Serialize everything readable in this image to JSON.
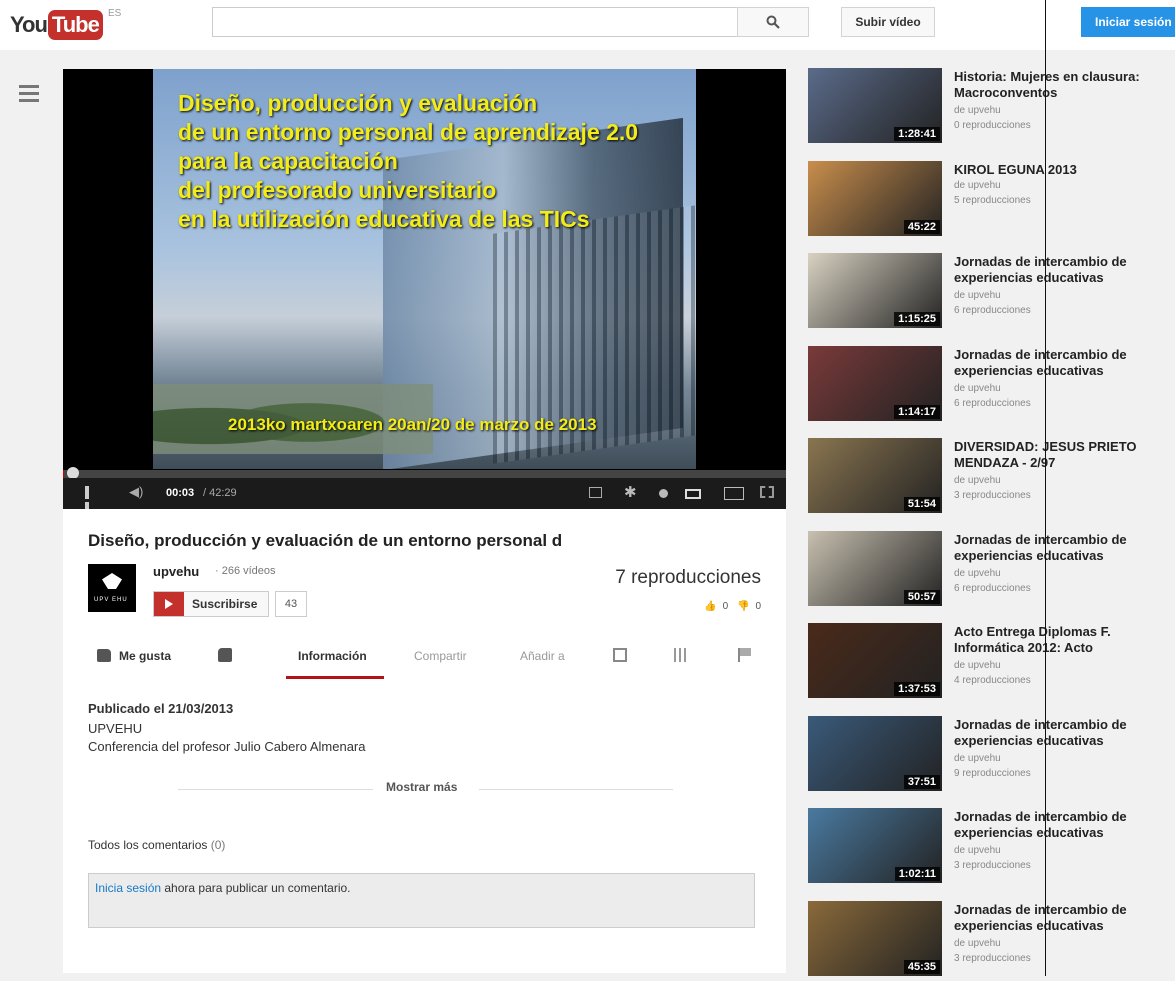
{
  "header": {
    "logo_you": "You",
    "logo_tube": "Tube",
    "locale": "ES",
    "search_placeholder": "",
    "upload_label": "Subir vídeo",
    "signin_label": "Iniciar sesión"
  },
  "player": {
    "slide_title_lines": [
      "Diseño, producción y evaluación",
      "de un entorno personal de aprendizaje 2.0",
      "para la capacitación",
      "del profesorado universitario",
      "en la utilización educativa de las TICs"
    ],
    "slide_date": "2013ko martxoaren 20an/20 de marzo de 2013",
    "time_current": "00:03",
    "time_total": "/ 42:29",
    "progress": 0.001
  },
  "video": {
    "title": "Diseño, producción y evaluación de un entorno personal d",
    "channel": "upvehu",
    "video_count": "· 266 vídeos",
    "subscribe_label": "Suscribirse",
    "subscriber_count": "43",
    "views": "7 reproducciones",
    "likes": "0",
    "dislikes": "0",
    "avatar_text": "UPV   EHU"
  },
  "tabs": {
    "like": "Me gusta",
    "info": "Información",
    "share": "Compartir",
    "add_to": "Añadir a"
  },
  "description": {
    "published": "Publicado el 21/03/2013",
    "line1": "UPVEHU",
    "line2": "Conferencia del profesor Julio Cabero Almenara",
    "show_more": "Mostrar más"
  },
  "comments": {
    "heading": "Todos los comentarios",
    "count": "(0)",
    "signin_link": "Inicia sesión",
    "signin_rest": " ahora para publicar un comentario."
  },
  "related": [
    {
      "title": "Historia: Mujeres en clausura: Macroconventos",
      "by": "de upvehu",
      "views": "0 reproducciones",
      "duration": "1:28:41",
      "color": "#5a6b8a"
    },
    {
      "title": "KIROL EGUNA 2013",
      "by": "de upvehu",
      "views": "5 reproducciones",
      "duration": "45:22",
      "color": "#c98e4c"
    },
    {
      "title": "Jornadas de intercambio de experiencias educativas",
      "by": "de upvehu",
      "views": "6 reproducciones",
      "duration": "1:15:25",
      "color": "#d9d2c2"
    },
    {
      "title": "Jornadas de intercambio de experiencias educativas",
      "by": "de upvehu",
      "views": "6 reproducciones",
      "duration": "1:14:17",
      "color": "#7a3a3a"
    },
    {
      "title": "DIVERSIDAD: JESUS PRIETO MENDAZA - 2/97",
      "by": "de upvehu",
      "views": "3 reproducciones",
      "duration": "51:54",
      "color": "#8a7550"
    },
    {
      "title": "Jornadas de intercambio de experiencias educativas",
      "by": "de upvehu",
      "views": "6 reproducciones",
      "duration": "50:57",
      "color": "#c8c0b0"
    },
    {
      "title": "Acto Entrega Diplomas F. Informática 2012: Acto",
      "by": "de upvehu",
      "views": "4 reproducciones",
      "duration": "1:37:53",
      "color": "#4a2a1a"
    },
    {
      "title": "Jornadas de intercambio de experiencias educativas",
      "by": "de upvehu",
      "views": "9 reproducciones",
      "duration": "37:51",
      "color": "#3a5a7a"
    },
    {
      "title": "Jornadas de intercambio de experiencias educativas",
      "by": "de upvehu",
      "views": "3 reproducciones",
      "duration": "1:02:11",
      "color": "#4a7aa0"
    },
    {
      "title": "Jornadas de intercambio de experiencias educativas",
      "by": "de upvehu",
      "views": "3 reproducciones",
      "duration": "45:35",
      "color": "#8a6a3a"
    }
  ]
}
